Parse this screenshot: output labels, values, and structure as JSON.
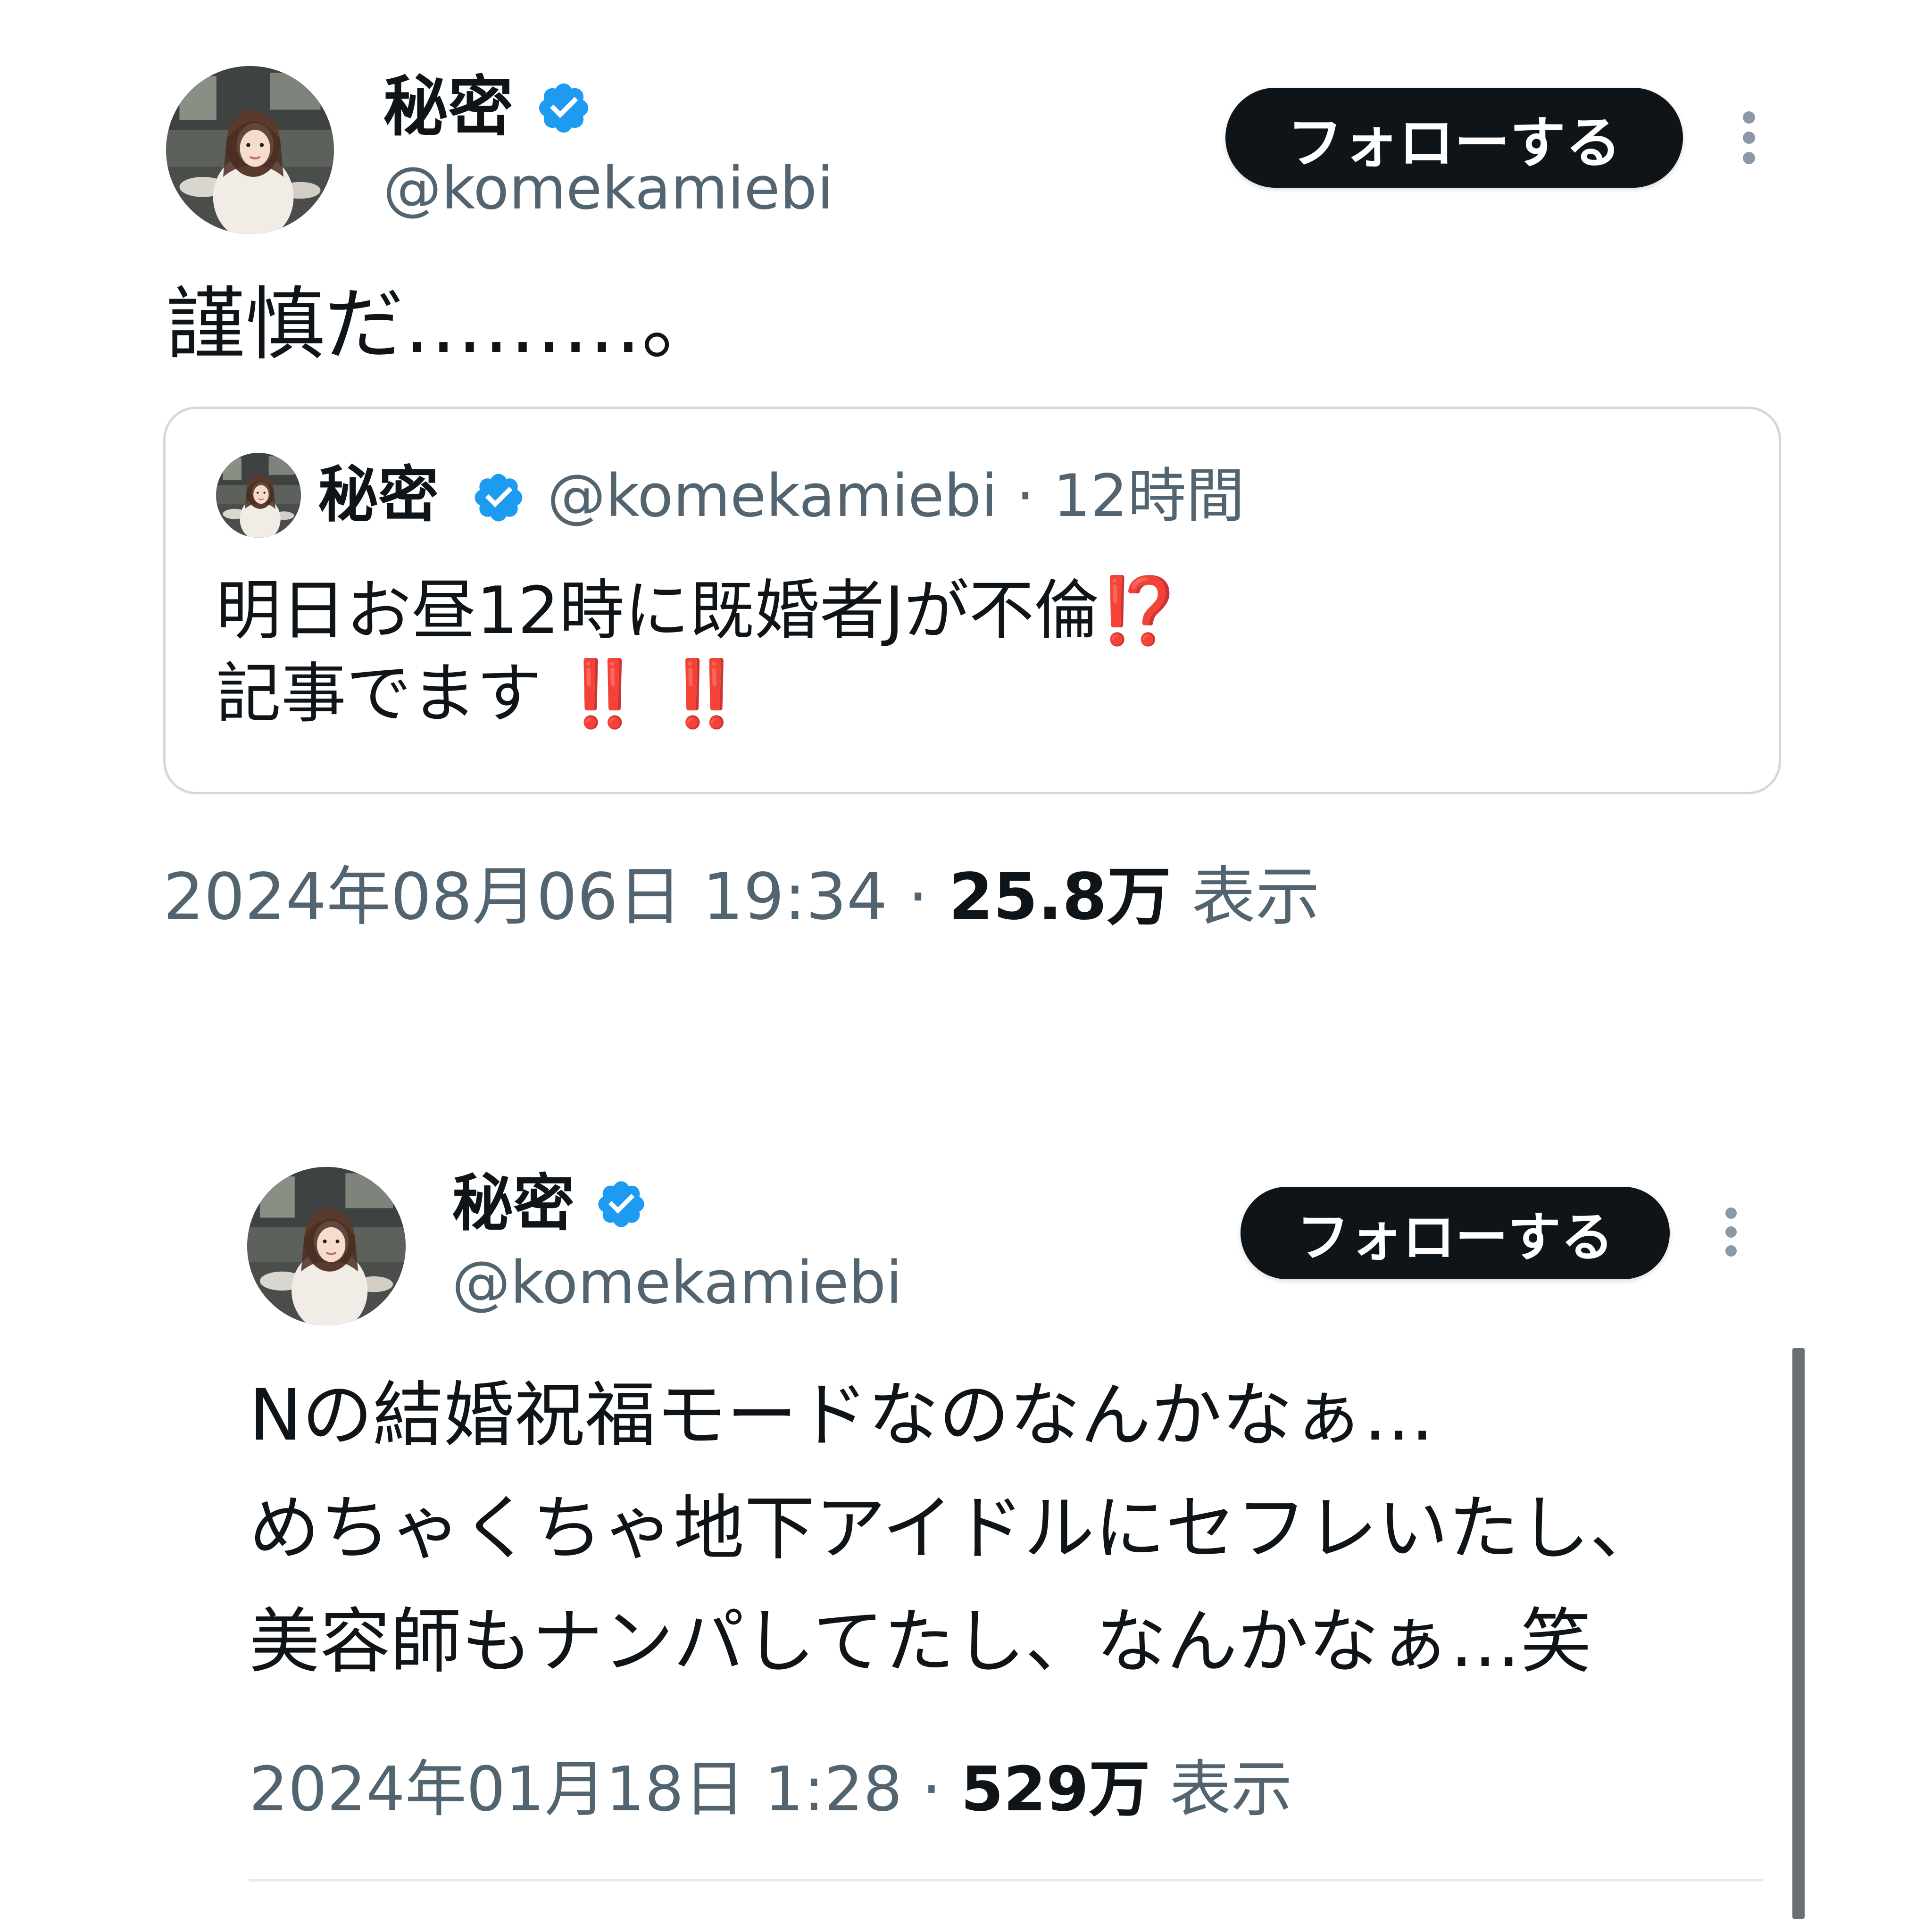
{
  "tweet1": {
    "author": {
      "display_name": "秘密",
      "handle": "@komekamiebi",
      "verified_icon": "verified-badge-icon",
      "avatar_icon": "profile-photo-avatar"
    },
    "follow_label": "フォローする",
    "more_icon": "more-vertical-icon",
    "text": "謹慎だ………。",
    "quote": {
      "display_name": "秘密",
      "handle": "@komekamiebi",
      "separator": "·",
      "time_ago": "12時間",
      "line1": "明日お昼12時に既婚者Jが不倫",
      "line1_emoji": "⁉️",
      "line2": "記事でます",
      "line2_emoji_1": "‼️",
      "line2_emoji_2": "‼️"
    },
    "timestamp": "2024年08月06日 19:34",
    "separator": "·",
    "views_count": "25.8万",
    "views_label": "表示"
  },
  "tweet2": {
    "author": {
      "display_name": "秘密",
      "handle": "@komekamiebi",
      "verified_icon": "verified-badge-icon",
      "avatar_icon": "profile-photo-avatar"
    },
    "follow_label": "フォローする",
    "more_icon": "more-vertical-icon",
    "lines": [
      "Nの結婚祝福モードなのなんかなぁ…",
      "めちゃくちゃ地下アイドルにセフレいたし、",
      "美容師もナンパしてたし、なんかなぁ…笑"
    ],
    "timestamp": "2024年01月18日 1:28",
    "separator": "·",
    "views_count": "529万",
    "views_label": "表示"
  },
  "colors": {
    "text_primary": "#0f1419",
    "text_secondary": "#536471",
    "verified_blue": "#1d9bf0",
    "follow_button_bg": "#0f1419",
    "border": "#cfd9de",
    "emoji_red": "#e0202b"
  }
}
